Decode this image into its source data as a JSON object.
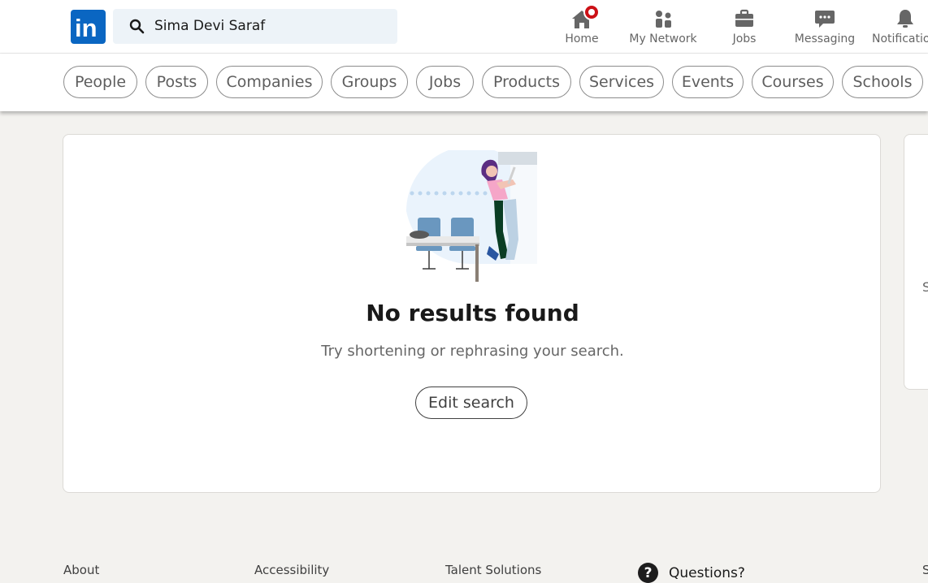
{
  "header": {
    "logo_text": "in",
    "search": {
      "value": "Sima Devi Saraf",
      "icon": "search-icon"
    },
    "nav": [
      {
        "label": "Home",
        "icon": "home-icon",
        "has_badge": true
      },
      {
        "label": "My Network",
        "icon": "people-icon"
      },
      {
        "label": "Jobs",
        "icon": "briefcase-icon"
      },
      {
        "label": "Messaging",
        "icon": "chat-bubble-icon"
      },
      {
        "label": "Notificatio",
        "icon": "bell-icon"
      }
    ]
  },
  "filters": [
    "People",
    "Posts",
    "Companies",
    "Groups",
    "Jobs",
    "Products",
    "Services",
    "Events",
    "Courses",
    "Schools"
  ],
  "results": {
    "title": "No results found",
    "subtitle": "Try shortening or rephrasing your search.",
    "edit_button": "Edit search"
  },
  "side_card": {
    "partial_text": "S"
  },
  "footer": {
    "links": [
      "About",
      "Accessibility",
      "Talent Solutions"
    ],
    "questions": {
      "icon_glyph": "?",
      "label": "Questions?"
    },
    "partial_text": "S"
  },
  "colors": {
    "brand": "#0a66c2",
    "badge": "#cc1016",
    "page_bg": "#f3f2ef",
    "search_bg": "#edf3f8"
  }
}
